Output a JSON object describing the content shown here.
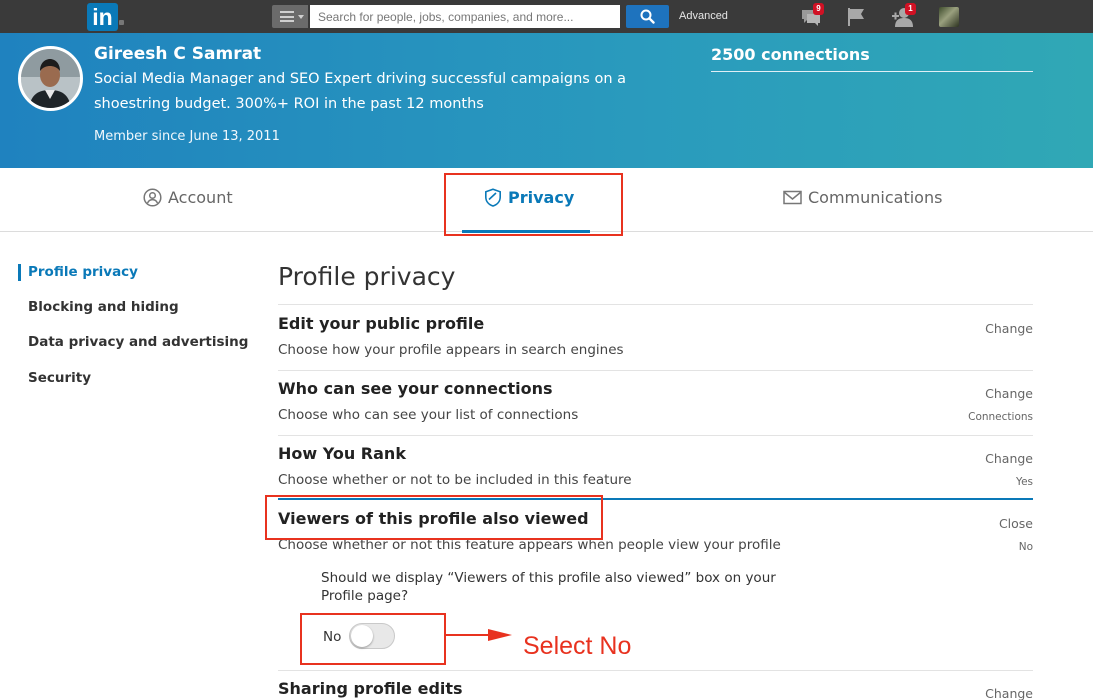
{
  "nav": {
    "logo_text": "in",
    "search_placeholder": "Search for people, jobs, companies, and more...",
    "advanced_label": "Advanced",
    "messages_badge": "9",
    "notifications_badge": "1"
  },
  "profile": {
    "name": "Gireesh C Samrat",
    "headline": "Social Media Manager and SEO Expert driving successful campaigns on a shoestring budget. 300%+ ROI in the past 12 months",
    "member_since": "Member since June 13, 2011",
    "connections": "2500 connections"
  },
  "tabs": [
    {
      "label": "Account",
      "icon": "person-circle-icon",
      "active": false
    },
    {
      "label": "Privacy",
      "icon": "shield-icon",
      "active": true
    },
    {
      "label": "Communications",
      "icon": "envelope-icon",
      "active": false
    }
  ],
  "sidebar": {
    "items": [
      {
        "label": "Profile privacy",
        "active": true
      },
      {
        "label": "Blocking and hiding",
        "active": false
      },
      {
        "label": "Data privacy and advertising",
        "active": false
      },
      {
        "label": "Security",
        "active": false
      }
    ]
  },
  "main": {
    "section_title": "Profile privacy",
    "settings": [
      {
        "title": "Edit your public profile",
        "description": "Choose how your profile appears in search engines",
        "action": "Change",
        "value": ""
      },
      {
        "title": "Who can see your connections",
        "description": "Choose who can see your list of connections",
        "action": "Change",
        "value": "Connections"
      },
      {
        "title": "How You Rank",
        "description": "Choose whether or not to be included in this feature",
        "action": "Change",
        "value": "Yes"
      },
      {
        "title": "Viewers of this profile also viewed",
        "description": "Choose whether or not this feature appears when people view your profile",
        "action": "Close",
        "value": "No"
      },
      {
        "title": "Sharing profile edits",
        "description": "",
        "action": "Change",
        "value": ""
      }
    ],
    "expanded": {
      "question": "Should we display “Viewers of this profile also viewed” box on your Profile page?",
      "toggle_label": "No",
      "toggle_on": false
    }
  },
  "annotation": {
    "text": "Select No",
    "color": "#e8321f"
  },
  "colors": {
    "brand": "#0a79b8",
    "topbar": "#3a3a3a",
    "header_start": "#1f82bf",
    "header_end": "#30a8b5"
  }
}
